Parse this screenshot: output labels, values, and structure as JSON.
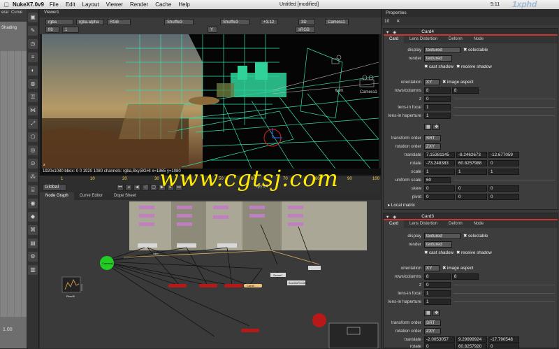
{
  "menubar": {
    "app": "NukeX7.0v9",
    "items": [
      "File",
      "Edit",
      "Layout",
      "Viewer",
      "Render",
      "Cache",
      "Help"
    ],
    "doc_title": "Untitled [modified]",
    "clock": "5:11",
    "brand": "1xphd"
  },
  "left_panel": {
    "tabs": [
      "eral",
      "Curve"
    ],
    "shading": "Shading",
    "value": "1.00"
  },
  "viewer": {
    "tab": "Viewer1",
    "channels": "rgba",
    "alpha": "rgba.alpha",
    "rgb": "RGB",
    "a_input": "Shuffle3",
    "b_input": "Shuffle3",
    "gain": "+3.12",
    "mode": "3D",
    "camera": "Camera1",
    "lut": "sRGB",
    "frame": "f/8",
    "frame_val": "1",
    "y_val": "Y",
    "info": "1920x1080 bbox: 0 0 1920 1080 channels: rgba,Sky,BGHI  x=1865 y=1080",
    "cam_label": "cam",
    "camera_label": "Camera1"
  },
  "timeline": {
    "global": "Global",
    "frame": "1",
    "ticks": [
      "1",
      "10",
      "20",
      "30",
      "40",
      "50",
      "60",
      "70",
      "80",
      "90",
      "100"
    ],
    "fps": "fps 24"
  },
  "watermark": "www.cgtsj.com",
  "nodegraph": {
    "tabs": [
      "Node Graph",
      "Curve Editor",
      "Dope Sheet"
    ],
    "nodes": {
      "camera": "Camera1",
      "read": "Read5",
      "scene": "Scene1",
      "scanline": "ScanlineRender1",
      "cards": [
        "Card1",
        "Card2",
        "Card3",
        "Card4"
      ],
      "groups": [
        "Group001",
        "Group002",
        "Group003"
      ],
      "cam_lbl": "cam"
    }
  },
  "properties": {
    "title": "Properties",
    "count": "10",
    "panels": [
      {
        "name": "Card4",
        "tabs": [
          "Card",
          "Lens Distortion",
          "Deform",
          "Node"
        ],
        "display": "textured",
        "selectable": "selectable",
        "render": "textured",
        "cast_shadow": "cast shadow",
        "receive_shadow": "receive shadow",
        "orientation": "XY",
        "image_aspect": "image aspect",
        "rows": "8",
        "cols": "8",
        "z": "0",
        "lens_focal": "1",
        "lens_haperture": "1",
        "transform_order": "SRT",
        "rotation_order": "ZXY",
        "translate": [
          "7.15381145",
          "-8.2462673",
          "-12.677059"
        ],
        "rotate": [
          "-73.248383",
          "60.8257988",
          "0"
        ],
        "scale": [
          "1",
          "1",
          "1"
        ],
        "uniform_scale": "60",
        "skew": [
          "0",
          "0",
          "0"
        ],
        "pivot": [
          "0",
          "0",
          "0"
        ],
        "local_matrix": "Local matrix"
      },
      {
        "name": "Card3",
        "tabs": [
          "Card",
          "Lens Distortion",
          "Deform",
          "Node"
        ],
        "display": "textured",
        "selectable": "selectable",
        "render": "textured",
        "cast_shadow": "cast shadow",
        "receive_shadow": "receive shadow",
        "orientation": "XY",
        "image_aspect": "image aspect",
        "rows": "8",
        "cols": "8",
        "z": "0",
        "lens_focal": "1",
        "lens_haperture": "1",
        "transform_order": "SRT",
        "rotation_order": "ZXY",
        "translate": [
          "-2.0053057",
          "9.29999924",
          "-17.790548"
        ],
        "rotate": [
          "0",
          "60.8257920",
          "0"
        ]
      }
    ],
    "labels": {
      "display": "display",
      "render": "render",
      "orientation": "orientation",
      "rows_columns": "rows/columns",
      "z": "z",
      "lens_focal": "lens-in focal",
      "lens_haperture": "lens-in haperture",
      "transform_order": "transform order",
      "rotation_order": "rotation order",
      "translate": "translate",
      "rotate": "rotate",
      "scale": "scale",
      "uniform_scale": "uniform scale",
      "skew": "skew",
      "pivot": "pivot",
      "x": "x",
      "y": "y",
      "zz": "z"
    }
  },
  "colors": {
    "accent_red": "#cc3333",
    "grid_cyan": "#38e0b0",
    "watermark": "#ffea00",
    "camera_node": "#22cc22"
  }
}
